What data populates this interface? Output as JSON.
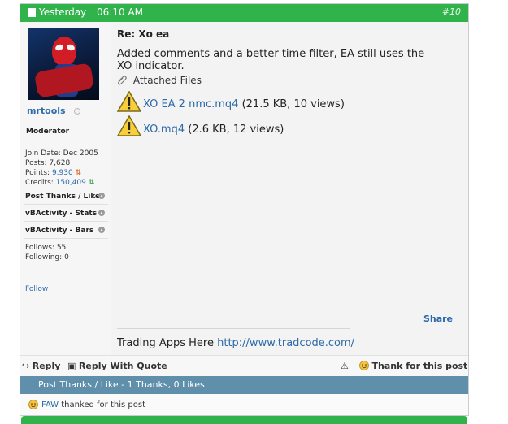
{
  "header": {
    "date": "Yesterday",
    "time": "06:10 AM",
    "post_number": "#10"
  },
  "user": {
    "name": "mrtools",
    "role": "Moderator",
    "join_date_label": "Join Date:",
    "join_date": "Dec 2005",
    "posts_label": "Posts:",
    "posts": "7,628",
    "points_label": "Points:",
    "points": "9,930",
    "credits_label": "Credits:",
    "credits": "150,409",
    "sections": [
      "Post Thanks / Like",
      "vBActivity - Stats",
      "vBActivity - Bars"
    ],
    "follows_label": "Follows:",
    "follows": "55",
    "following_label": "Following:",
    "following": "0",
    "follow_link": "Follow"
  },
  "post": {
    "title": "Re: Xo ea",
    "body": "Added comments and a better time filter, EA still uses the XO indicator.",
    "attachments_label": "Attached Files",
    "attachments": [
      {
        "name": "XO EA 2 nmc.mq4",
        "info": "(21.5 KB, 10 views)"
      },
      {
        "name": "XO.mq4",
        "info": "(2.6 KB, 12 views)"
      }
    ],
    "share": "Share",
    "signature_text": "Trading Apps Here",
    "signature_link": "http://www.tradcode.com/"
  },
  "footer": {
    "reply": "Reply",
    "reply_quote": "Reply With Quote",
    "thank": "Thank for this post"
  },
  "thanks": {
    "bar": "Post Thanks / Like - 1 Thanks, 0 Likes",
    "user": "FAW",
    "text": "thanked for this post"
  },
  "colors": {
    "accent_green": "#2fb34a",
    "link_blue": "#2c6aa8",
    "thanks_bar": "#5f8fab"
  }
}
